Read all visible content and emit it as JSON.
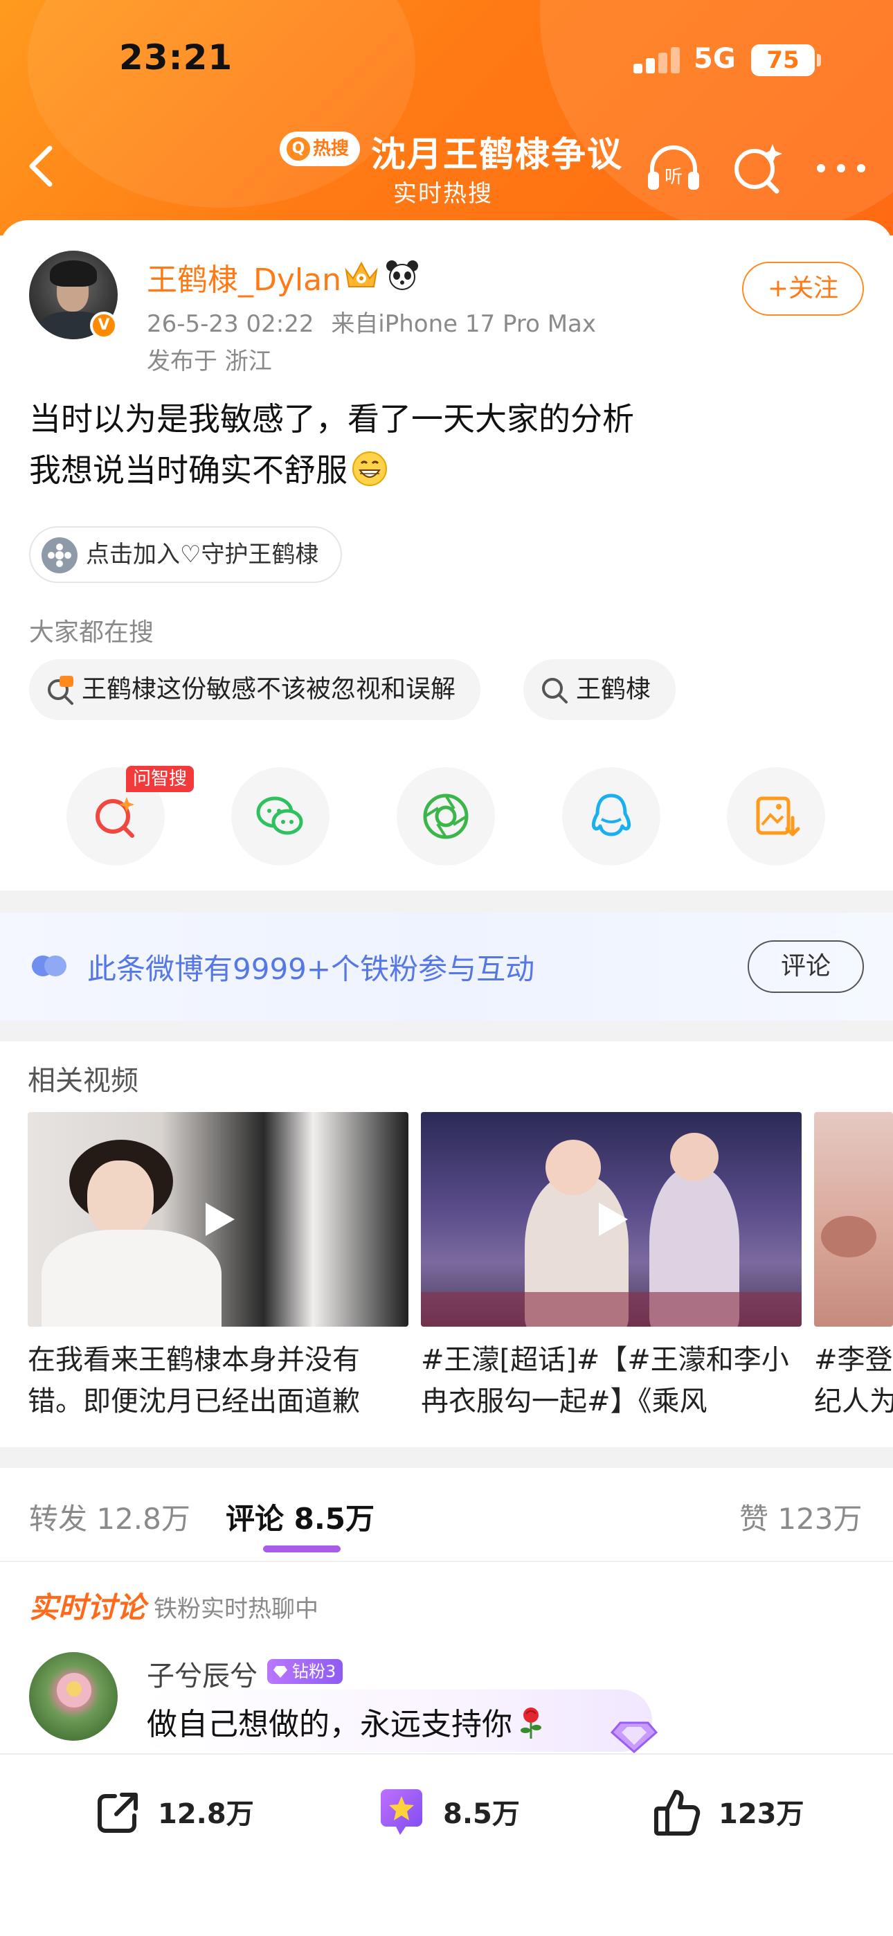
{
  "status_bar": {
    "time": "23:21",
    "network": "5G",
    "battery": "75"
  },
  "header": {
    "hot_badge": "热搜",
    "topic_title": "沈月王鹤棣争议",
    "topic_subtitle": "实时热搜",
    "background_color": "#ff7a14"
  },
  "post": {
    "author": "王鹤棣_Dylan",
    "timestamp": "26-5-23 02:22",
    "device": "来自iPhone 17 Pro Max",
    "location": "发布于 浙江",
    "follow_label": "+关注",
    "text_line1": "当时以为是我敏感了，看了一天大家的分析",
    "text_line2": "我想说当时确实不舒服",
    "guard_chip": "点击加入♡守护王鹤棣"
  },
  "searches": {
    "label": "大家都在搜",
    "items": [
      {
        "text": "王鹤棣这份敏感不该被忽视和误解",
        "icon": "hot-search-icon"
      },
      {
        "text": "王鹤棣",
        "icon": "search-icon"
      }
    ]
  },
  "share": {
    "ai_tag": "问智搜",
    "items": [
      "ai-search-icon",
      "wechat-icon",
      "moments-icon",
      "qq-icon",
      "save-image-icon"
    ]
  },
  "fans_band": {
    "text": "此条微博有9999+个铁粉参与互动",
    "button": "评论"
  },
  "related_videos": {
    "heading": "相关视频",
    "items": [
      {
        "caption_line1": "在我看来王鹤棣本身并没有",
        "caption_line2": "错。即便沈月已经出面道歉"
      },
      {
        "caption_line1": "#王濛[超话]#【#王濛和李小",
        "caption_line2": "冉衣服勾一起#】《乘风"
      },
      {
        "caption_line1": "#李登科",
        "caption_line2": "纪人为"
      }
    ]
  },
  "tabs": {
    "repost": "转发 12.8万",
    "comments": "评论 8.5万",
    "likes": "赞 123万"
  },
  "live_discussion": {
    "title": "实时讨论",
    "subtitle": "铁粉实时热聊中"
  },
  "comment": {
    "name": "子兮辰兮",
    "badge": "钻粉3",
    "text": "做自己想做的，永远支持你"
  },
  "bottom_bar": {
    "repost_count": "12.8万",
    "comment_count": "8.5万",
    "like_count": "123万"
  }
}
